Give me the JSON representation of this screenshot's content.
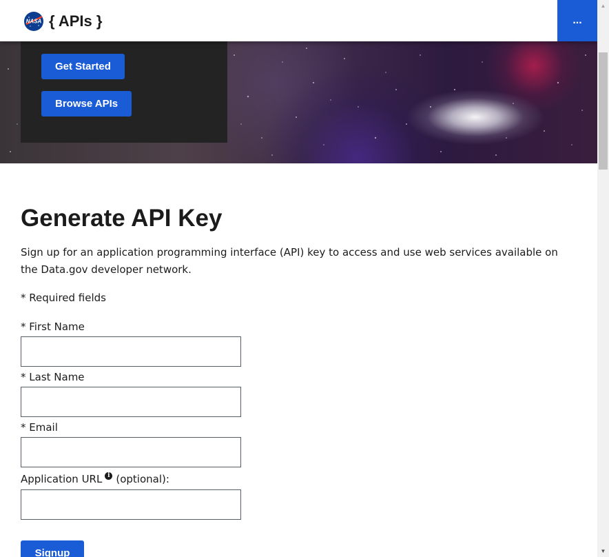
{
  "header": {
    "site_title": "{ APIs }",
    "logo_text": "NASA",
    "menu_label": "..."
  },
  "hero": {
    "get_started_label": "Get Started",
    "browse_apis_label": "Browse APIs"
  },
  "main": {
    "title": "Generate API Key",
    "intro": "Sign up for an application programming interface (API) key to access and use web services available on the Data.gov developer network.",
    "required_note": "* Required fields"
  },
  "form": {
    "first_name_label": "* First Name",
    "first_name_value": "",
    "last_name_label": "* Last Name",
    "last_name_value": "",
    "email_label": "* Email",
    "email_value": "",
    "app_url_label": "Application URL",
    "app_url_suffix": "(optional):",
    "app_url_value": "",
    "info_icon_glyph": "i",
    "signup_label": "Signup"
  },
  "scrollbar": {
    "up_glyph": "▲",
    "down_glyph": "▼"
  },
  "colors": {
    "accent": "#1a5bd6",
    "hero_box": "#232323",
    "text": "#1b1b1b"
  }
}
